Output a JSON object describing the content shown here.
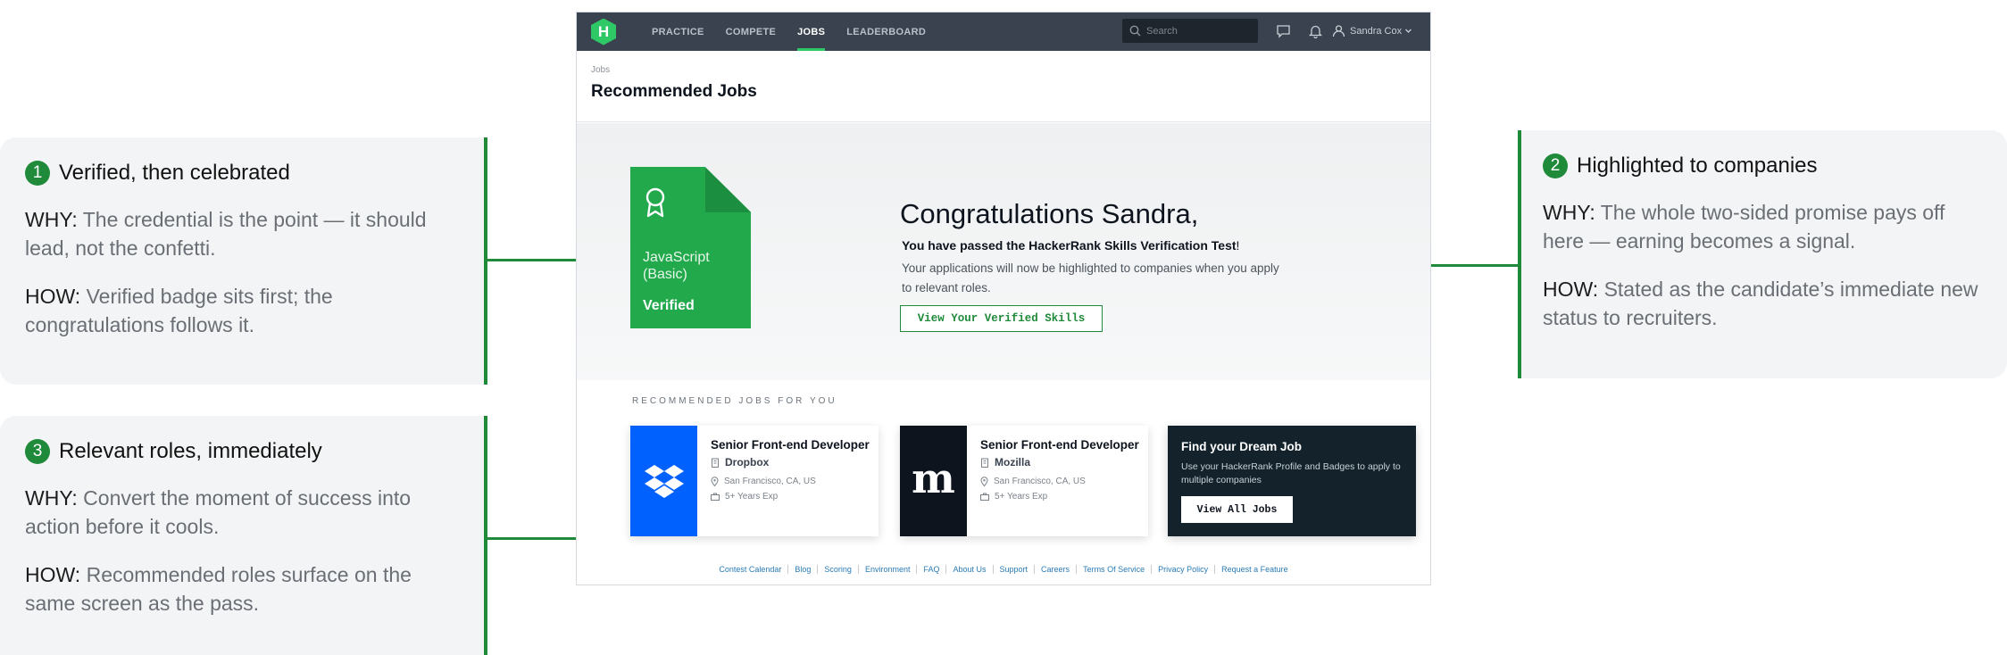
{
  "callouts": {
    "c1": {
      "number": "1",
      "title": "Verified, then celebrated",
      "why_label": "WHY:",
      "why": " The credential is the point — it should lead, not the confetti.",
      "how_label": "HOW:",
      "how": " Verified badge sits first; the congratulations follows it."
    },
    "c2": {
      "number": "2",
      "title": "Highlighted to companies",
      "why_label": "WHY:",
      "why": "  The whole two-sided promise pays off here — earning becomes a signal.",
      "how_label": "HOW:",
      "how": " Stated as the candidate’s immediate new status to recruiters."
    },
    "c3": {
      "number": "3",
      "title": "Relevant roles, immediately",
      "why_label": "WHY:",
      "why": " Convert the moment of success into action before it cools.",
      "how_label": "HOW:",
      "how": " Recommended roles surface on the same screen as the pass."
    }
  },
  "app": {
    "nav": {
      "logo_letter": "H",
      "links": [
        "PRACTICE",
        "COMPETE",
        "JOBS",
        "LEADERBOARD"
      ],
      "active": "JOBS",
      "search_placeholder": "Search",
      "user_name": "Sandra Cox"
    },
    "header": {
      "breadcrumb": "Jobs",
      "title": "Recommended Jobs"
    },
    "hero": {
      "badge_skill": "JavaScript (Basic)",
      "badge_status": "Verified",
      "congrats": "Congratulations Sandra,",
      "passed_bold": "You have passed the HackerRank Skills Verification Test",
      "passed_end": "!",
      "apply_text": "Your applications will now be highlighted to companies when you apply to relevant roles.",
      "button": "View Your Verified Skills"
    },
    "recommended_title": "RECOMMENDED JOBS FOR YOU",
    "jobs": [
      {
        "title": "Senior Front-end Developer",
        "company": "Dropbox",
        "location": "San Francisco, CA, US",
        "experience": "5+ Years Exp",
        "logo": "dropbox-logo"
      },
      {
        "title": "Senior Front-end Developer",
        "company": "Mozilla",
        "location": "San Francisco, CA, US",
        "experience": "5+ Years Exp",
        "logo": "mozilla-logo",
        "logo_letter": "m"
      }
    ],
    "dream": {
      "title": "Find your Dream Job",
      "text": "Use your HackerRank Profile and Badges to apply to multiple companies",
      "button": "View All Jobs"
    },
    "footer": [
      "Contest Calendar",
      "Blog",
      "Scoring",
      "Environment",
      "FAQ",
      "About Us",
      "Support",
      "Careers",
      "Terms Of Service",
      "Privacy Policy",
      "Request a Feature"
    ],
    "colors": {
      "accent": "#1f8a3a",
      "nav_bg": "#39424e",
      "hr_green": "#2ec866",
      "dropbox_blue": "#0061fe"
    }
  }
}
